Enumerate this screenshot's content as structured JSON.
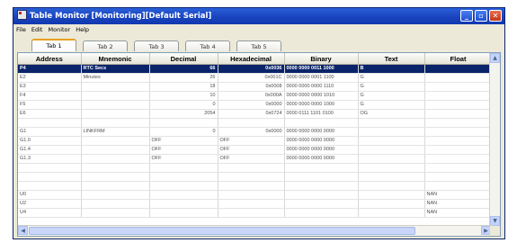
{
  "window": {
    "title": "Table Monitor [Monitoring][Default Serial]"
  },
  "menu": [
    "File",
    "Edit",
    "Monitor",
    "Help"
  ],
  "tabs": [
    "Tab 1",
    "Tab 2",
    "Tab 3",
    "Tab 4",
    "Tab 5"
  ],
  "active_tab": 0,
  "columns": [
    "Address",
    "Mnemonic",
    "Decimal",
    "Hexadecimal",
    "Binary",
    "Text",
    "Float"
  ],
  "rows": [
    [
      "P4",
      "RTC Secs",
      "66",
      "0x0036",
      "0000 0000 0011 1000",
      "B",
      ""
    ],
    [
      "E2",
      "Minutes",
      "26",
      "0x001C",
      "0000 0000 0001 1100",
      "G",
      ""
    ],
    [
      "E3",
      "",
      "18",
      "0x0008",
      "0000 0000 0000 1110",
      "G",
      ""
    ],
    [
      "F4",
      "",
      "10",
      "0x000A",
      "0000 0000 0000 1010",
      "G",
      ""
    ],
    [
      "F5",
      "",
      "0",
      "0x0000",
      "0000 0000 0000 1000",
      "G",
      ""
    ],
    [
      "E6",
      "",
      "2054",
      "0x0724",
      "0000 0111 1101 0100",
      "OG",
      ""
    ],
    [
      "",
      "",
      "",
      "",
      "",
      "",
      ""
    ],
    [
      "G1",
      "LINKFRM",
      "0",
      "0x0000",
      "0000 0000 0000 0000",
      "",
      ""
    ],
    [
      "G1.0",
      "",
      "OFF",
      "OFF",
      "0000 0000 0000 0000",
      "",
      ""
    ],
    [
      "G1.4",
      "",
      "OFF",
      "OFF",
      "0000 0000 0000 0000",
      "",
      ""
    ],
    [
      "G1.3",
      "",
      "OFF",
      "OFF",
      "0000 0000 0000 0000",
      "",
      ""
    ],
    [
      "",
      "",
      "",
      "",
      "",
      "",
      ""
    ],
    [
      "",
      "",
      "",
      "",
      "",
      "",
      ""
    ],
    [
      "",
      "",
      "",
      "",
      "",
      "",
      ""
    ],
    [
      "U0",
      "",
      "",
      "",
      "",
      "",
      "NAN"
    ],
    [
      "U2",
      "",
      "",
      "",
      "",
      "",
      "NAN"
    ],
    [
      "U4",
      "",
      "",
      "",
      "",
      "",
      "NAN"
    ]
  ],
  "selected_row": 0
}
